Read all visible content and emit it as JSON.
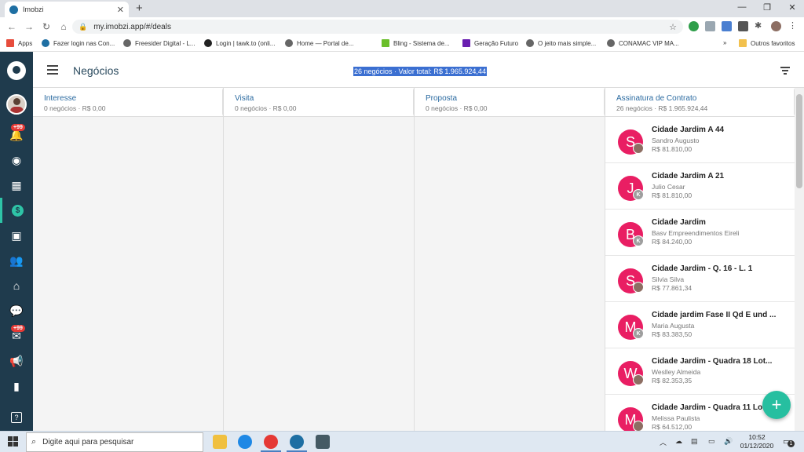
{
  "browser": {
    "tab_title": "Imobzi",
    "url": "my.imobzi.app/#/deals",
    "bookmarks": [
      "Apps",
      "Fazer login nas Con...",
      "Freesider Digital - L...",
      "Login | tawk.to (onli...",
      "Home — Portal de...",
      "Bling - Sistema de...",
      "Geração Futuro",
      "O jeito mais simple...",
      "CONAMAC VIP MA..."
    ],
    "more_bookmarks": "»",
    "other_bookmarks": "Outros favoritos"
  },
  "sidebar": {
    "notifications_badge": "+99",
    "messages_badge": "+99"
  },
  "header": {
    "title": "Negócios",
    "summary": "26 negócios · Valor total: R$ 1.965.924,44"
  },
  "columns": [
    {
      "title": "Interesse",
      "subtitle": "0 negócios · R$ 0,00"
    },
    {
      "title": "Visita",
      "subtitle": "0 negócios · R$ 0,00"
    },
    {
      "title": "Proposta",
      "subtitle": "0 negócios · R$ 0,00"
    },
    {
      "title": "Assinatura de Contrato",
      "subtitle": "26 negócios · R$ 1.965.924,44"
    }
  ],
  "deals": [
    {
      "initial": "S",
      "owner": "photo",
      "title": "Cidade Jardim A 44",
      "person": "Sandro Augusto",
      "value": "R$ 81.810,00"
    },
    {
      "initial": "J",
      "owner": "K",
      "title": "Cidade Jardim A 21",
      "person": "Julio Cesar",
      "value": "R$ 81.810,00"
    },
    {
      "initial": "B",
      "owner": "K",
      "title": "Cidade Jardim",
      "person": "Basv Empreendimentos Eireli",
      "value": "R$ 84.240,00"
    },
    {
      "initial": "S",
      "owner": "photo",
      "title": "Cidade Jardim - Q. 16 - L. 1",
      "person": "Silvia Silva",
      "value": "R$ 77.861,34"
    },
    {
      "initial": "M",
      "owner": "K",
      "title": "Cidade jardim Fase II Qd E und ...",
      "person": "Maria Augusta",
      "value": "R$ 83.383,50"
    },
    {
      "initial": "W",
      "owner": "photo",
      "title": "Cidade Jardim - Quadra 18 Lot...",
      "person": "Weslley Almeida",
      "value": "R$ 82.353,35"
    },
    {
      "initial": "M",
      "owner": "photo",
      "title": "Cidade Jardim - Quadra 11 Lot...",
      "person": "Melissa Paulista",
      "value": "R$ 64.512,00"
    }
  ],
  "fab": "+",
  "taskbar": {
    "search_placeholder": "Digite aqui para pesquisar",
    "time": "10:52",
    "date": "01/12/2020",
    "notification_count": "1"
  },
  "colors": {
    "sidebar": "#1f3b4d",
    "accent": "#26bfa0",
    "avatar": "#e91e63",
    "column_title": "#2a6aa0"
  }
}
